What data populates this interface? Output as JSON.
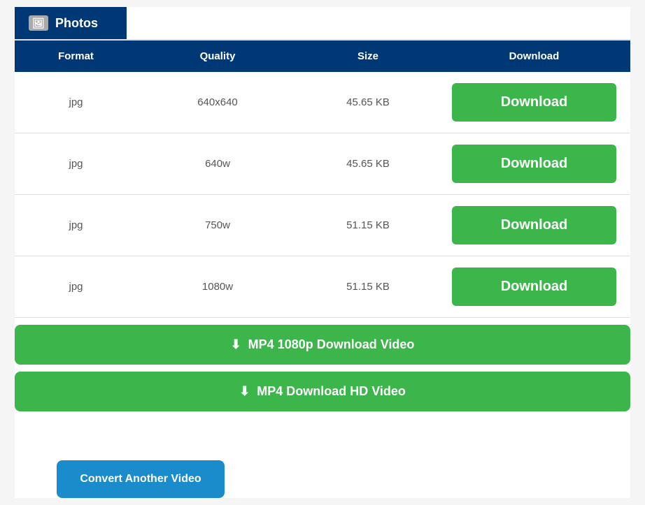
{
  "tab": {
    "icon": "🖼",
    "label": "Photos"
  },
  "table": {
    "headers": {
      "format": "Format",
      "quality": "Quality",
      "size": "Size",
      "download": "Download"
    },
    "rows": [
      {
        "format": "jpg",
        "quality": "640x640",
        "size": "45.65 KB",
        "download_label": "Download"
      },
      {
        "format": "jpg",
        "quality": "640w",
        "size": "45.65 KB",
        "download_label": "Download"
      },
      {
        "format": "jpg",
        "quality": "750w",
        "size": "51.15 KB",
        "download_label": "Download"
      },
      {
        "format": "jpg",
        "quality": "1080w",
        "size": "51.15 KB",
        "download_label": "Download"
      }
    ]
  },
  "big_buttons": {
    "mp4_1080p": "MP4 1080p Download Video",
    "mp4_hd": "MP4 Download HD Video"
  },
  "convert_button": {
    "label": "Convert Another Video"
  },
  "colors": {
    "header_bg": "#003876",
    "green": "#3cb54a",
    "blue": "#1a8ccc"
  }
}
